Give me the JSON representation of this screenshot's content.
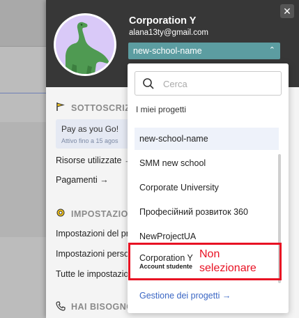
{
  "drawer": {
    "org_name": "Corporation Y",
    "email": "alana13ty@gmail.com",
    "current_project": "new-school-name",
    "close_label": "✕"
  },
  "subscription": {
    "title": "SOTTOSCRIZ",
    "plan_name": "Pay as you Go!",
    "plan_expiry": "Attivo fino a 15 agos",
    "resources_link": "Risorse utilizzate →",
    "payments_link": "Pagamenti →"
  },
  "settings": {
    "title": "IMPOSTAZIO",
    "item1": "Impostazioni del pr",
    "item2": "Impostazioni perso",
    "item3": "Tutte le impostazio"
  },
  "help": {
    "title": "HAI BISOGNO"
  },
  "dropdown": {
    "search_placeholder": "Cerca",
    "section_title": "I miei progetti",
    "projects": [
      {
        "name": "new-school-name"
      },
      {
        "name": "SMM new school"
      },
      {
        "name": "Corporate University"
      },
      {
        "name": "Професійний розвиток 360"
      },
      {
        "name": "NewProjectUA"
      },
      {
        "name": "Corporation Y",
        "sub": "Account studente"
      }
    ],
    "manage_link": "Gestione dei progetti →"
  },
  "annotation": {
    "line1": "Non",
    "line2": "selezionare",
    "color": "#e81123"
  },
  "colors": {
    "header_bg": "#373737",
    "select_bg": "#5c9da1",
    "link": "#3a66c4"
  }
}
